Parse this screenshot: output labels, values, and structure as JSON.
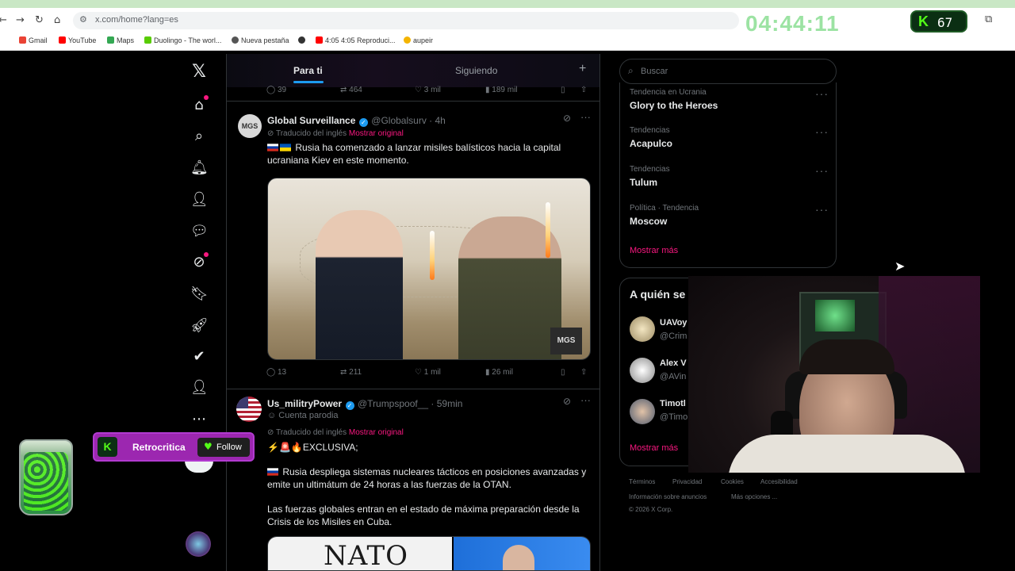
{
  "browser": {
    "url": "x.com/home?lang=es",
    "timer": "04:44:11",
    "kick_badge": "67",
    "bookmarks": [
      "Gmail",
      "YouTube",
      "Maps",
      "Duolingo - The worl...",
      "Nueva pestaña",
      "4:05 4:05 Reproduci...",
      "aupeir"
    ]
  },
  "timeline": {
    "tabs": [
      "Para ti",
      "Siguiendo"
    ],
    "add_tab": "+",
    "prev_actions": {
      "replies": "39",
      "reposts": "464",
      "likes": "3 mil",
      "views": "189 mil"
    },
    "posts": [
      {
        "name": "Global Surveillance",
        "handle": "@Globalsurv · 4h",
        "avatar": "MGS",
        "translated": "Traducido del inglés",
        "show_original": "Mostrar original",
        "text": "Rusia ha comenzado a lanzar misiles balísticos hacia la capital ucraniana Kiev en este momento.",
        "media_watermark": "MGS",
        "actions": {
          "replies": "13",
          "reposts": "211",
          "likes": "1 mil",
          "views": "26 mil"
        }
      },
      {
        "name": "Us_militryPower",
        "handle": "@Trumpspoof__ · 59min",
        "parody": "Cuenta parodia",
        "translated": "Traducido del inglés",
        "show_original": "Mostrar original",
        "headline": "EXCLUSIVA;",
        "text1": "Rusia despliega sistemas nucleares tácticos en posiciones avanzadas y emite un ultimátum de 24 horas a las fuerzas de la OTAN.",
        "text2": "Las fuerzas globales entran en el estado de máxima preparación desde la Crisis de los Misiles en Cuba.",
        "media_text": "NATO"
      }
    ]
  },
  "right": {
    "search_placeholder": "Buscar",
    "trends": [
      {
        "meta": "Tendencia en Ucrania",
        "name": "Glory to the Heroes"
      },
      {
        "meta": "Tendencias",
        "name": "Acapulco"
      },
      {
        "meta": "Tendencias",
        "name": "Tulum"
      },
      {
        "meta": "Política · Tendencia",
        "name": "Moscow"
      }
    ],
    "trends_more": "Mostrar más",
    "who_title": "A quién se",
    "who": [
      {
        "name": "UAVoy",
        "handle": "@Crim"
      },
      {
        "name": "Alex V",
        "handle": "@AVin"
      },
      {
        "name": "Timotl",
        "handle": "@Timo"
      }
    ],
    "who_more": "Mostrar más",
    "footer": {
      "terms": "Términos",
      "privacy": "Privacidad",
      "cookies": "Cookies",
      "access": "Accesibilidad",
      "ads": "Información sobre anuncios",
      "more": "Más opciones ...",
      "copy": "© 2026 X Corp."
    }
  },
  "overlay": {
    "streamer": "Retrocritica",
    "follow": "Follow"
  }
}
